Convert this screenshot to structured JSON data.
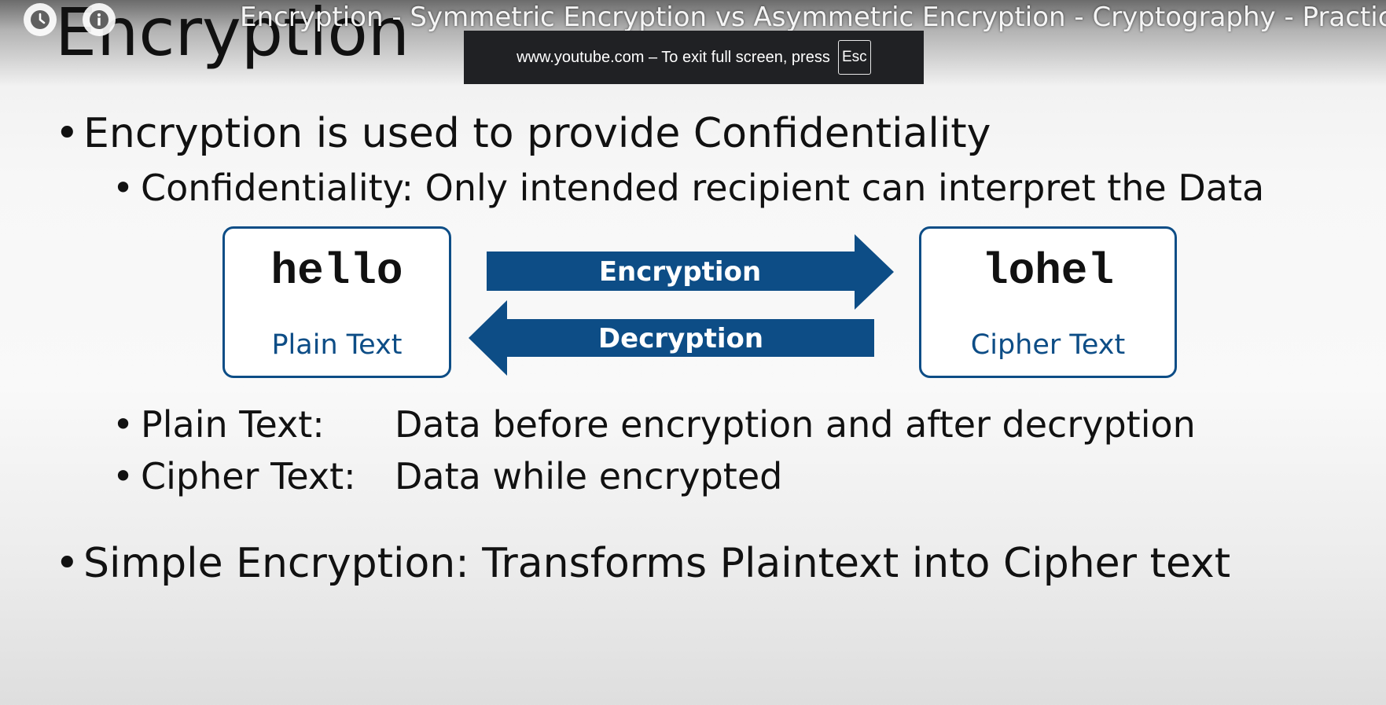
{
  "player": {
    "video_title": "Encryption - Symmetric Encryption vs Asymmetric Encryption - Cryptography - Practical T",
    "watch_later_icon": "clock-icon",
    "info_icon": "info-icon",
    "fullscreen_notice": "www.youtube.com – To exit full screen, press",
    "fullscreen_key": "Esc"
  },
  "slide": {
    "title": "Encryption",
    "bullet_glyph": "•",
    "point1": "Encryption is used to provide Confidentiality",
    "sub_confidentiality": "Confidentiality:  Only intended recipient can interpret the Data",
    "diagram": {
      "plain_word": "hello",
      "plain_label": "Plain Text",
      "cipher_word": "lohel",
      "cipher_label": "Cipher Text",
      "encrypt_label": "Encryption",
      "decrypt_label": "Decryption",
      "accent_color": "#0d4d86"
    },
    "def_plain_term": "Plain Text:",
    "def_plain_text": "Data before encryption and after decryption",
    "def_cipher_term": "Cipher Text:",
    "def_cipher_text": "Data while encrypted",
    "point2": "Simple Encryption:  Transforms Plaintext into Cipher text"
  }
}
